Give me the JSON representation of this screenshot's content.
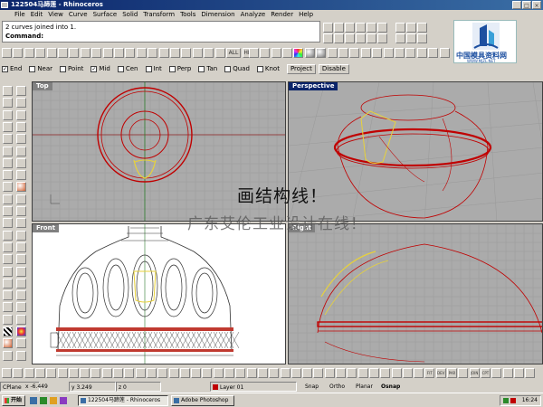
{
  "window": {
    "title": "122504马蹄莲 - Rhinoceros"
  },
  "menu": [
    "File",
    "Edit",
    "View",
    "Curve",
    "Surface",
    "Solid",
    "Transform",
    "Tools",
    "Dimension",
    "Analyze",
    "Render",
    "Help"
  ],
  "command": {
    "history": "2 curves joined into 1.",
    "prompt": "Command:"
  },
  "toolbar_labels": {
    "all": "ALL",
    "hide": "HIDE"
  },
  "osnap": {
    "items": [
      {
        "label": "End",
        "checked": true
      },
      {
        "label": "Near",
        "checked": false
      },
      {
        "label": "Point",
        "checked": false
      },
      {
        "label": "Mid",
        "checked": true
      },
      {
        "label": "Cen",
        "checked": false
      },
      {
        "label": "Int",
        "checked": false
      },
      {
        "label": "Perp",
        "checked": false
      },
      {
        "label": "Tan",
        "checked": false
      },
      {
        "label": "Quad",
        "checked": false
      },
      {
        "label": "Knot",
        "checked": false
      }
    ],
    "project_label": "Project",
    "disable_label": "Disable"
  },
  "viewports": {
    "top": "Top",
    "perspective": "Perspective",
    "front": "Front",
    "right": "Right"
  },
  "overlay": {
    "line1": "画结构线！",
    "line2": "广东艾伦工业设计在线！"
  },
  "logo": {
    "text": "中国模具资料网",
    "url": "WWW.MJZL.NET"
  },
  "bottom_toolbar_labels": [
    "FIT",
    "DEV",
    "PAR",
    "JOIN",
    "CPT"
  ],
  "status": {
    "cplane": "CPlane",
    "x": "x -6.449",
    "y": "y 3.249",
    "z": "z 0",
    "layer": "Layer 01",
    "panes": [
      "Snap",
      "Ortho",
      "Planar",
      "Osnap"
    ]
  },
  "taskbar": {
    "start": "开始",
    "tasks": [
      {
        "label": "122504马蹄莲 - Rhinoceros",
        "active": true
      },
      {
        "label": "Adobe Photoshop",
        "active": false
      }
    ],
    "clock": "16:24"
  },
  "colors": {
    "titlebar": "#0a246a",
    "curve": "#c00000",
    "highlight": "#e8d23a",
    "viewport_bg": "#ababab"
  }
}
